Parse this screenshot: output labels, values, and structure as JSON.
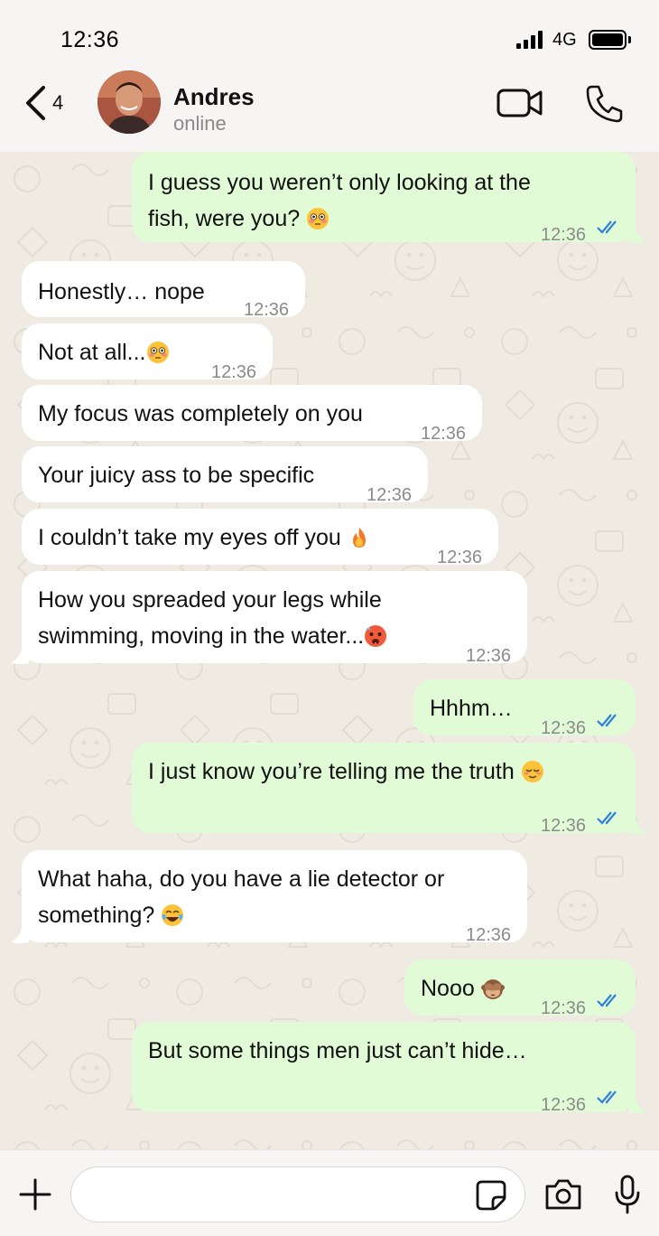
{
  "status_bar": {
    "time": "12:36",
    "network": "4G"
  },
  "header": {
    "back_count": "4",
    "contact_name": "Andres",
    "contact_status": "online"
  },
  "messages": [
    {
      "dir": "out",
      "lines": [
        "I guess you weren’t only looking at the",
        "fish, were you? "
      ],
      "emoji": "flushed-face",
      "time": "12:36",
      "read": true
    },
    {
      "dir": "in",
      "lines": [
        "Honestly… nope"
      ],
      "time": "12:36"
    },
    {
      "dir": "in",
      "lines": [
        "Not at all..."
      ],
      "emoji": "flushed-face",
      "time": "12:36"
    },
    {
      "dir": "in",
      "lines": [
        "My focus was completely on you"
      ],
      "time": "12:36"
    },
    {
      "dir": "in",
      "lines": [
        "Your juicy ass to be specific"
      ],
      "time": "12:36"
    },
    {
      "dir": "in",
      "lines": [
        "I couldn’t take my eyes off you "
      ],
      "emoji": "fire",
      "time": "12:36"
    },
    {
      "dir": "in",
      "lines": [
        "How you spreaded your legs while",
        "swimming, moving in the water..."
      ],
      "emoji": "hot-face",
      "time": "12:36"
    },
    {
      "dir": "out",
      "lines": [
        "Hhhm…"
      ],
      "time": "12:36",
      "read": true
    },
    {
      "dir": "out",
      "lines": [
        "I just know you’re telling me the truth "
      ],
      "emoji": "relieved-face",
      "time": "12:36",
      "read": true
    },
    {
      "dir": "in",
      "lines": [
        "What haha, do you have a lie detector or",
        "something? "
      ],
      "emoji": "tears-of-joy",
      "time": "12:36"
    },
    {
      "dir": "out",
      "lines": [
        "Nooo "
      ],
      "emoji": "see-no-evil-monkey",
      "time": "12:36",
      "read": true
    },
    {
      "dir": "out",
      "lines": [
        "But some things men just can’t hide…"
      ],
      "time": "12:36",
      "read": true
    }
  ],
  "input": {
    "placeholder": "",
    "value": ""
  },
  "colors": {
    "outgoing_bubble": "#e1fbd6",
    "incoming_bubble": "#ffffff",
    "chat_background": "#efeae2",
    "read_ticks": "#2f7fe0"
  }
}
